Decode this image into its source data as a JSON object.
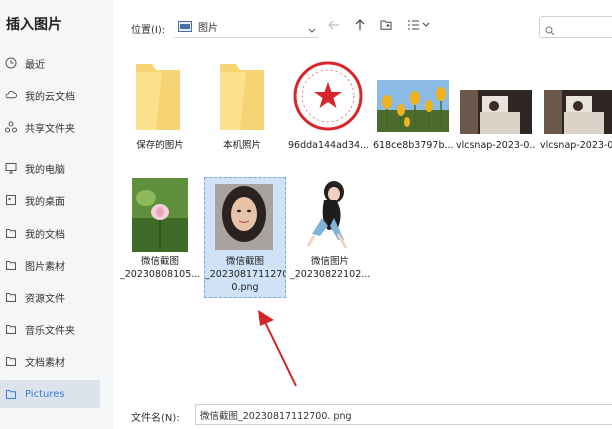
{
  "dialog": {
    "title": "插入图片"
  },
  "sidebar": {
    "items": [
      {
        "label": "最近",
        "icon": "clock-icon"
      },
      {
        "label": "我的云文档",
        "icon": "cloud-icon"
      },
      {
        "label": "共享文件夹",
        "icon": "share-icon"
      },
      {
        "label": "我的电脑",
        "icon": "monitor-icon"
      },
      {
        "label": "我的桌面",
        "icon": "desktop-icon"
      },
      {
        "label": "我的文档",
        "icon": "folder-outline-icon"
      },
      {
        "label": "图片素材",
        "icon": "folder-outline-icon"
      },
      {
        "label": "资源文件",
        "icon": "folder-outline-icon"
      },
      {
        "label": "音乐文件夹",
        "icon": "folder-outline-icon"
      },
      {
        "label": "文档素材",
        "icon": "folder-outline-icon"
      },
      {
        "label": "Pictures",
        "icon": "folder-outline-icon",
        "active": true
      }
    ]
  },
  "toolbar": {
    "location_label": "位置(I):",
    "location_value": "图片"
  },
  "files": [
    {
      "name": "保存的图片",
      "type": "folder"
    },
    {
      "name": "本机照片",
      "type": "folder"
    },
    {
      "name": "96dda144ad34...",
      "type": "image"
    },
    {
      "name": "618ce8b3797b...",
      "type": "image"
    },
    {
      "name": "vlcsnap-2023-0...",
      "type": "image"
    },
    {
      "name": "vlcsnap-2023-0...",
      "type": "image"
    },
    {
      "name_line1": "微信截图",
      "name_line2": "_20230808105...",
      "type": "image"
    },
    {
      "name_line1": "微信截图",
      "name_line2": "_20230817112700",
      "name_line3": "0.png",
      "type": "image",
      "selected": true
    },
    {
      "name_line1": "微信图片",
      "name_line2": "_20230822102...",
      "type": "image"
    }
  ],
  "bottom": {
    "filename_label": "文件名(N):",
    "filename_value": "微信截图_20230817112700. png"
  },
  "colors": {
    "accent": "#3b7ed8",
    "selection": "#cfe2f7",
    "arrow": "#d0262a"
  }
}
